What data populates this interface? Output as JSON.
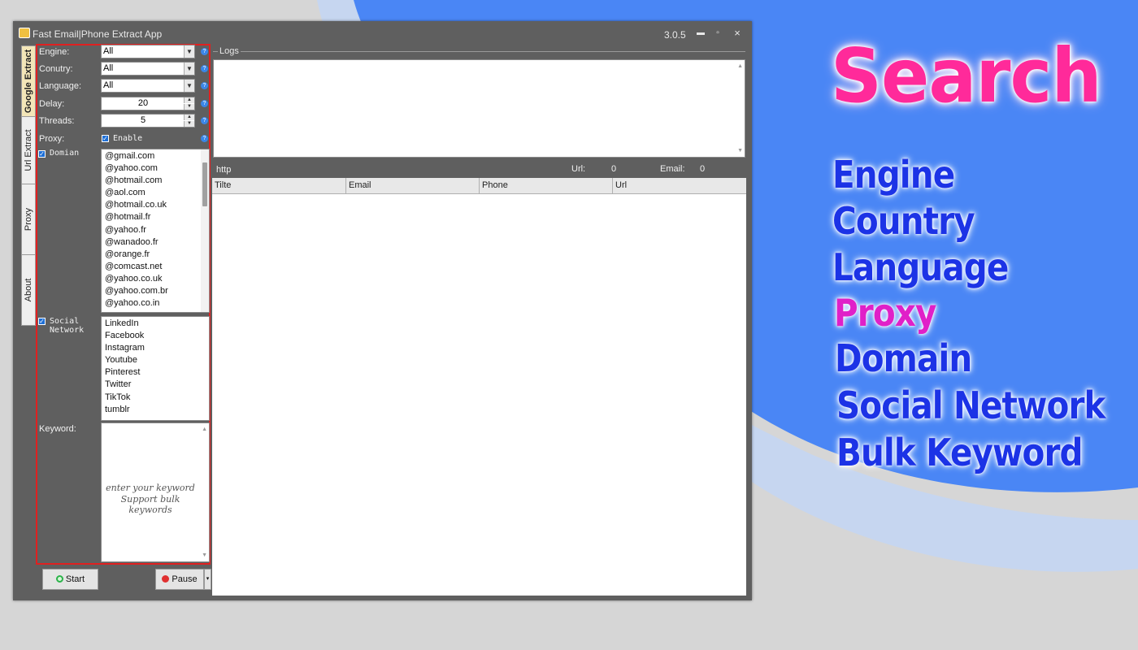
{
  "window": {
    "title": "Fast Email|Phone Extract App",
    "version": "3.0.5",
    "controls": {
      "minimize": "▬",
      "maximize": "▫",
      "close": "×"
    }
  },
  "tabs": [
    {
      "label": "Google Extract",
      "active": true
    },
    {
      "label": "Url Extract",
      "active": false
    },
    {
      "label": "Proxy",
      "active": false
    },
    {
      "label": "About",
      "active": false
    }
  ],
  "settings": {
    "engine": {
      "label": "Engine:",
      "value": "All"
    },
    "country": {
      "label": "Conutry:",
      "value": "All"
    },
    "language": {
      "label": "Language:",
      "value": "All"
    },
    "delay": {
      "label": "Delay:",
      "value": "20"
    },
    "threads": {
      "label": "Threads:",
      "value": "5"
    },
    "proxy": {
      "label": "Proxy:",
      "checkbox_label": "Enable",
      "checked": true
    },
    "help_glyph": "?"
  },
  "domain": {
    "checkbox_label": "Domian",
    "checked": true,
    "items": [
      "@gmail.com",
      "@yahoo.com",
      "@hotmail.com",
      "@aol.com",
      "@hotmail.co.uk",
      "@hotmail.fr",
      "@yahoo.fr",
      "@wanadoo.fr",
      "@orange.fr",
      "@comcast.net",
      "@yahoo.co.uk",
      "@yahoo.com.br",
      "@yahoo.co.in"
    ]
  },
  "social": {
    "checkbox_label": "Social Network",
    "checked": true,
    "items": [
      "LinkedIn",
      "Facebook",
      "Instagram",
      "Youtube",
      "Pinterest",
      "Twitter",
      "TikTok",
      "tumblr"
    ]
  },
  "keyword": {
    "label": "Keyword:",
    "placeholder_line1": "enter your keyword",
    "placeholder_line2": "Support bulk keywords"
  },
  "buttons": {
    "start": "Start",
    "pause": "Pause"
  },
  "logs": {
    "title": "Logs"
  },
  "status": {
    "url_text": "http",
    "url_label": "Url:",
    "url_count": "0",
    "email_label": "Email:",
    "email_count": "0"
  },
  "results": {
    "columns": [
      "Tilte",
      "Email",
      "Phone",
      "Url"
    ]
  },
  "promo": {
    "title": "Search",
    "features": [
      {
        "text": "Engine",
        "color": "#1c33e6"
      },
      {
        "text": "Country",
        "color": "#1c33e6"
      },
      {
        "text": "Language",
        "color": "#1c33e6"
      },
      {
        "text": "Proxy",
        "color": "#e020c8"
      },
      {
        "text": "Domain",
        "color": "#1c33e6"
      },
      {
        "text": "Social Network",
        "color": "#1c33e6"
      },
      {
        "text": "Bulk Keyword",
        "color": "#1c33e6"
      }
    ]
  },
  "colors": {
    "accent_red": "#e02020",
    "blob_blue": "#4a86f5",
    "window_gray": "#5f5f5f"
  }
}
